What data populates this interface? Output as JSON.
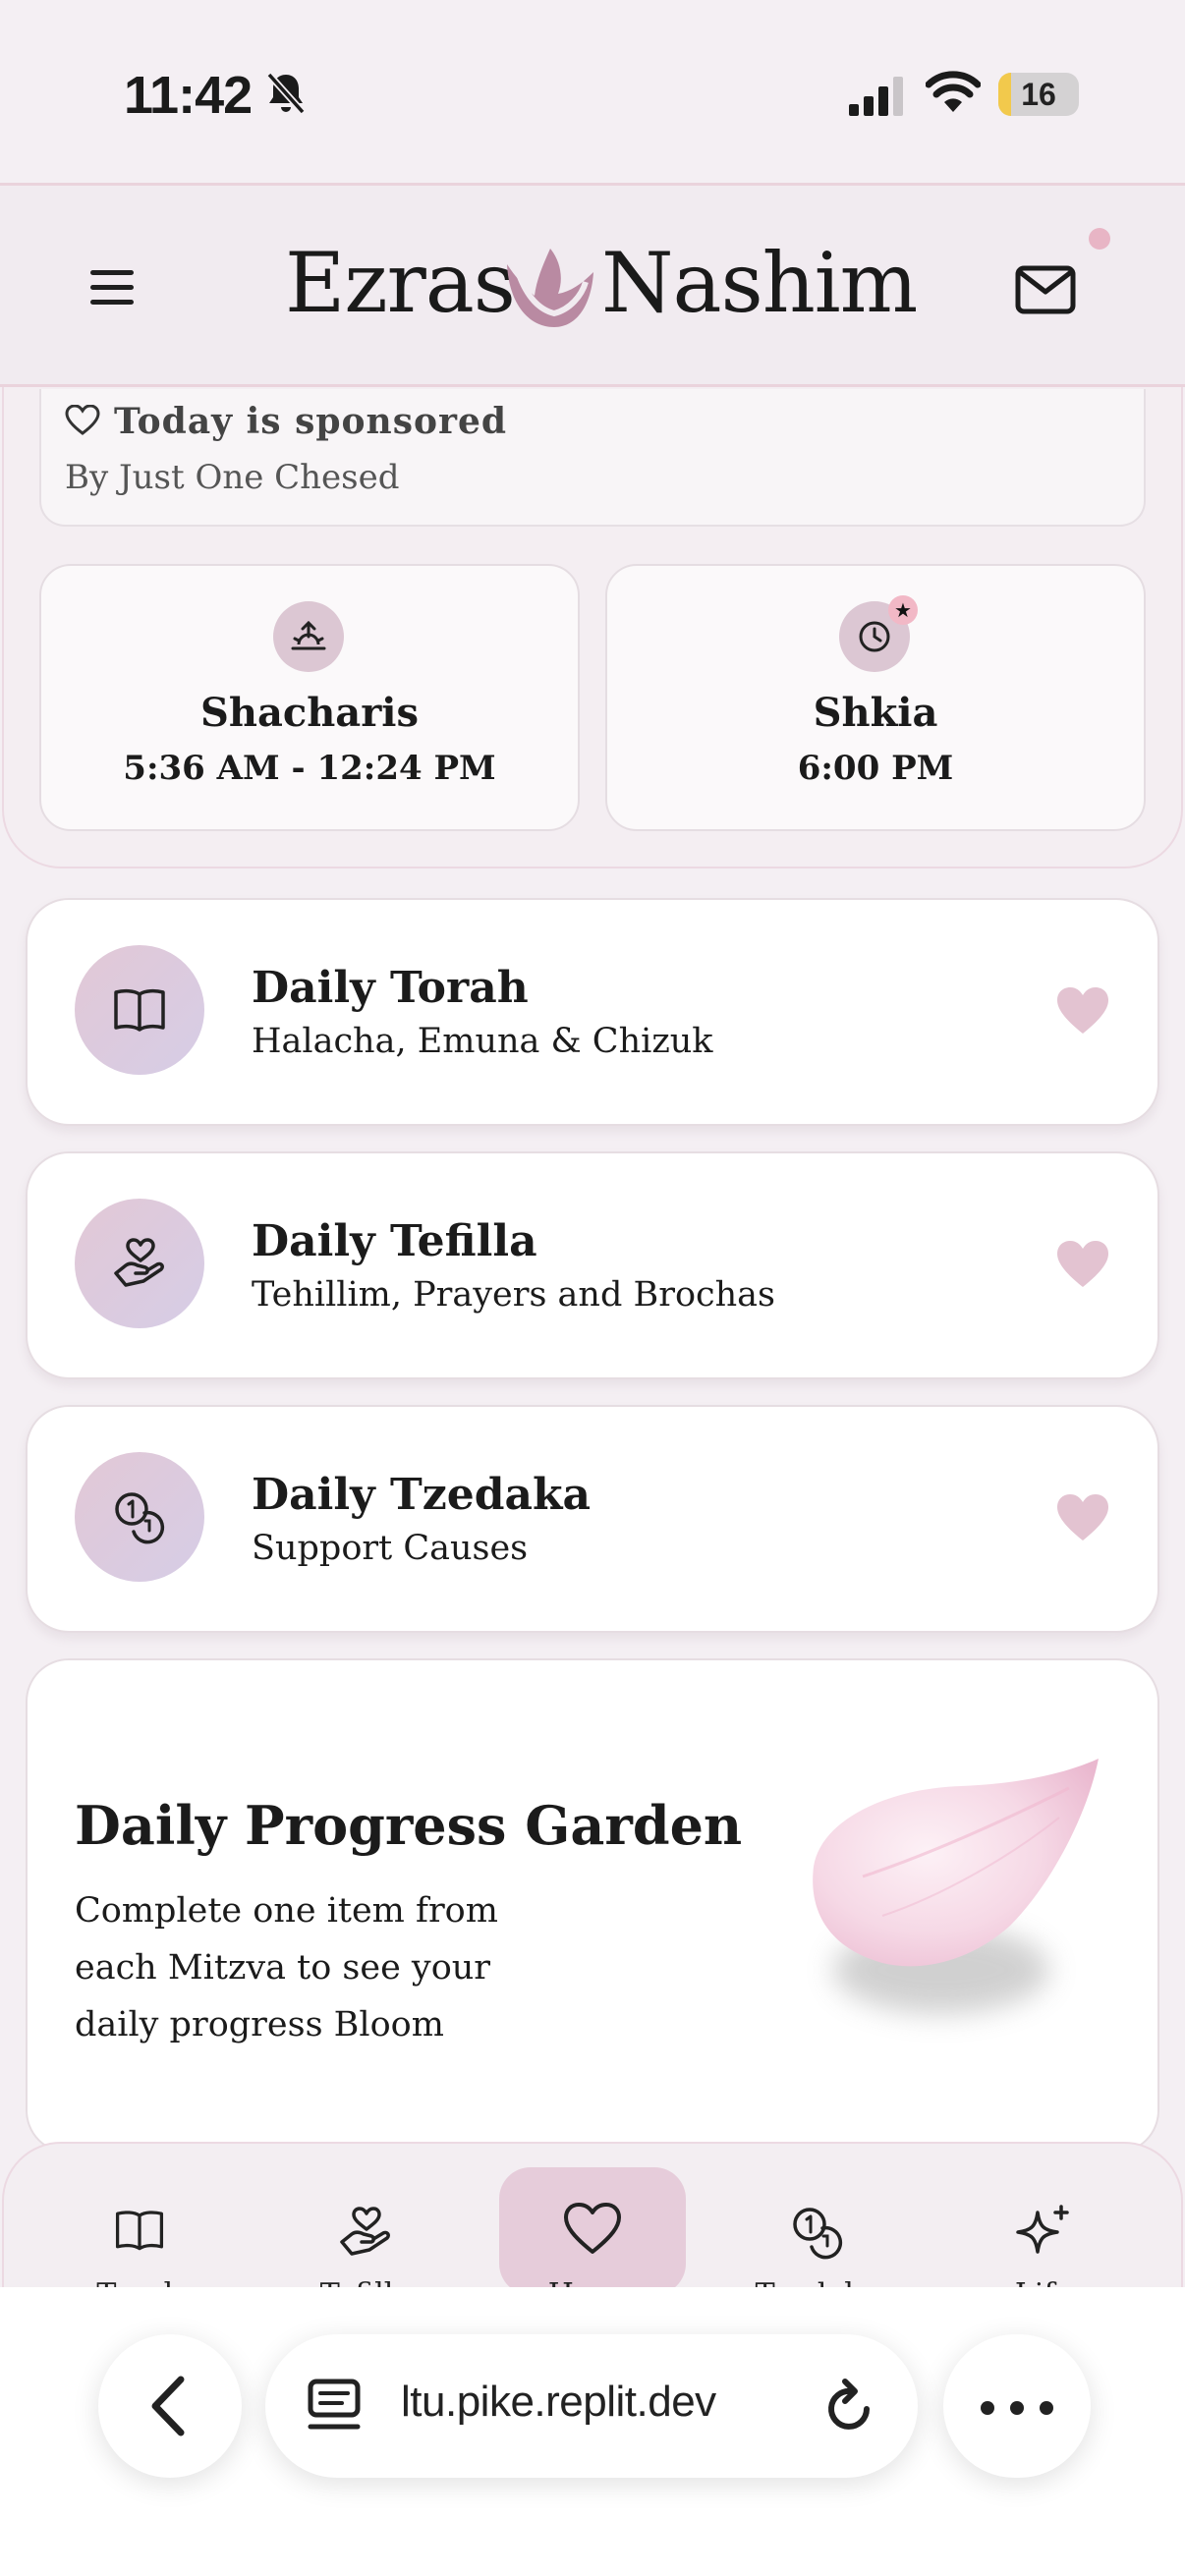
{
  "status_bar": {
    "time": "11:42",
    "battery": "16",
    "battery_fraction": 0.16
  },
  "header": {
    "logo_left": "Ezras",
    "logo_right": "Nashim"
  },
  "sponsor": {
    "title": "Today is sponsored",
    "subtitle": "By Just One Chesed"
  },
  "times": [
    {
      "title": "Shacharis",
      "value": "5:36 AM - 12:24 PM"
    },
    {
      "title": "Shkia",
      "value": "6:00 PM"
    }
  ],
  "features": [
    {
      "title": "Daily Torah",
      "subtitle": "Halacha, Emuna & Chizuk",
      "icon": "book-icon"
    },
    {
      "title": "Daily Tefilla",
      "subtitle": "Tehillim, Prayers and Brochas",
      "icon": "hand-heart-icon"
    },
    {
      "title": "Daily Tzedaka",
      "subtitle": "Support Causes",
      "icon": "coins-icon"
    }
  ],
  "garden": {
    "title": "Daily Progress Garden",
    "text": "Complete one item from each Mitzva to see your daily progress Bloom"
  },
  "bottom_nav": [
    {
      "label": "Torah",
      "icon": "book-icon"
    },
    {
      "label": "Tefilla",
      "icon": "hand-heart-icon"
    },
    {
      "label": "Home",
      "icon": "heart-icon",
      "active": true
    },
    {
      "label": "Tzedaka",
      "icon": "coins-icon"
    },
    {
      "label": "Life",
      "icon": "sparkle-icon"
    }
  ],
  "browser": {
    "url": "ltu.pike.replit.dev"
  },
  "colors": {
    "accent": "#e6ccda",
    "heart": "#e3c3d1",
    "background": "#f4eff3"
  }
}
